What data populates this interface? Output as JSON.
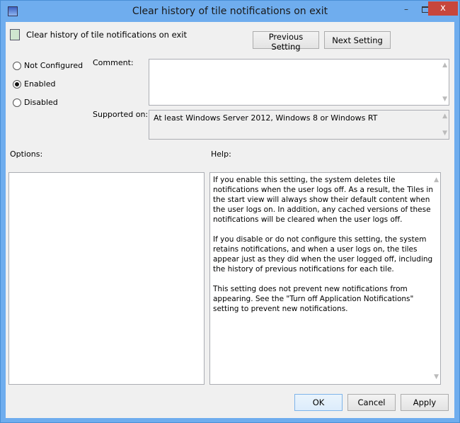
{
  "window": {
    "title": "Clear history of tile notifications on exit",
    "minimize": "–",
    "close": "x"
  },
  "header": {
    "policy_name": "Clear history of tile notifications on exit",
    "previous_setting": "Previous Setting",
    "next_setting": "Next Setting"
  },
  "state": {
    "options": [
      {
        "label": "Not Configured",
        "selected": false
      },
      {
        "label": "Enabled",
        "selected": true
      },
      {
        "label": "Disabled",
        "selected": false
      }
    ]
  },
  "comment": {
    "label": "Comment:",
    "value": ""
  },
  "supported": {
    "label": "Supported on:",
    "value": "At least Windows Server 2012, Windows 8 or Windows RT"
  },
  "options_label": "Options:",
  "help_label": "Help:",
  "help": [
    "If you enable this setting, the system deletes tile notifications when the user logs off. As a result, the Tiles in the start view will always show their default content when the user logs on. In addition, any cached versions of these notifications will be cleared when the user logs off.",
    "If you disable or do not configure this setting, the system retains notifications, and when a user logs on, the tiles appear just as they did when the user logged off, including the history of previous notifications for each tile.",
    "This setting does not prevent new notifications from appearing. See the \"Turn off Application Notifications\" setting to prevent new notifications."
  ],
  "footer": {
    "ok": "OK",
    "cancel": "Cancel",
    "apply": "Apply"
  }
}
